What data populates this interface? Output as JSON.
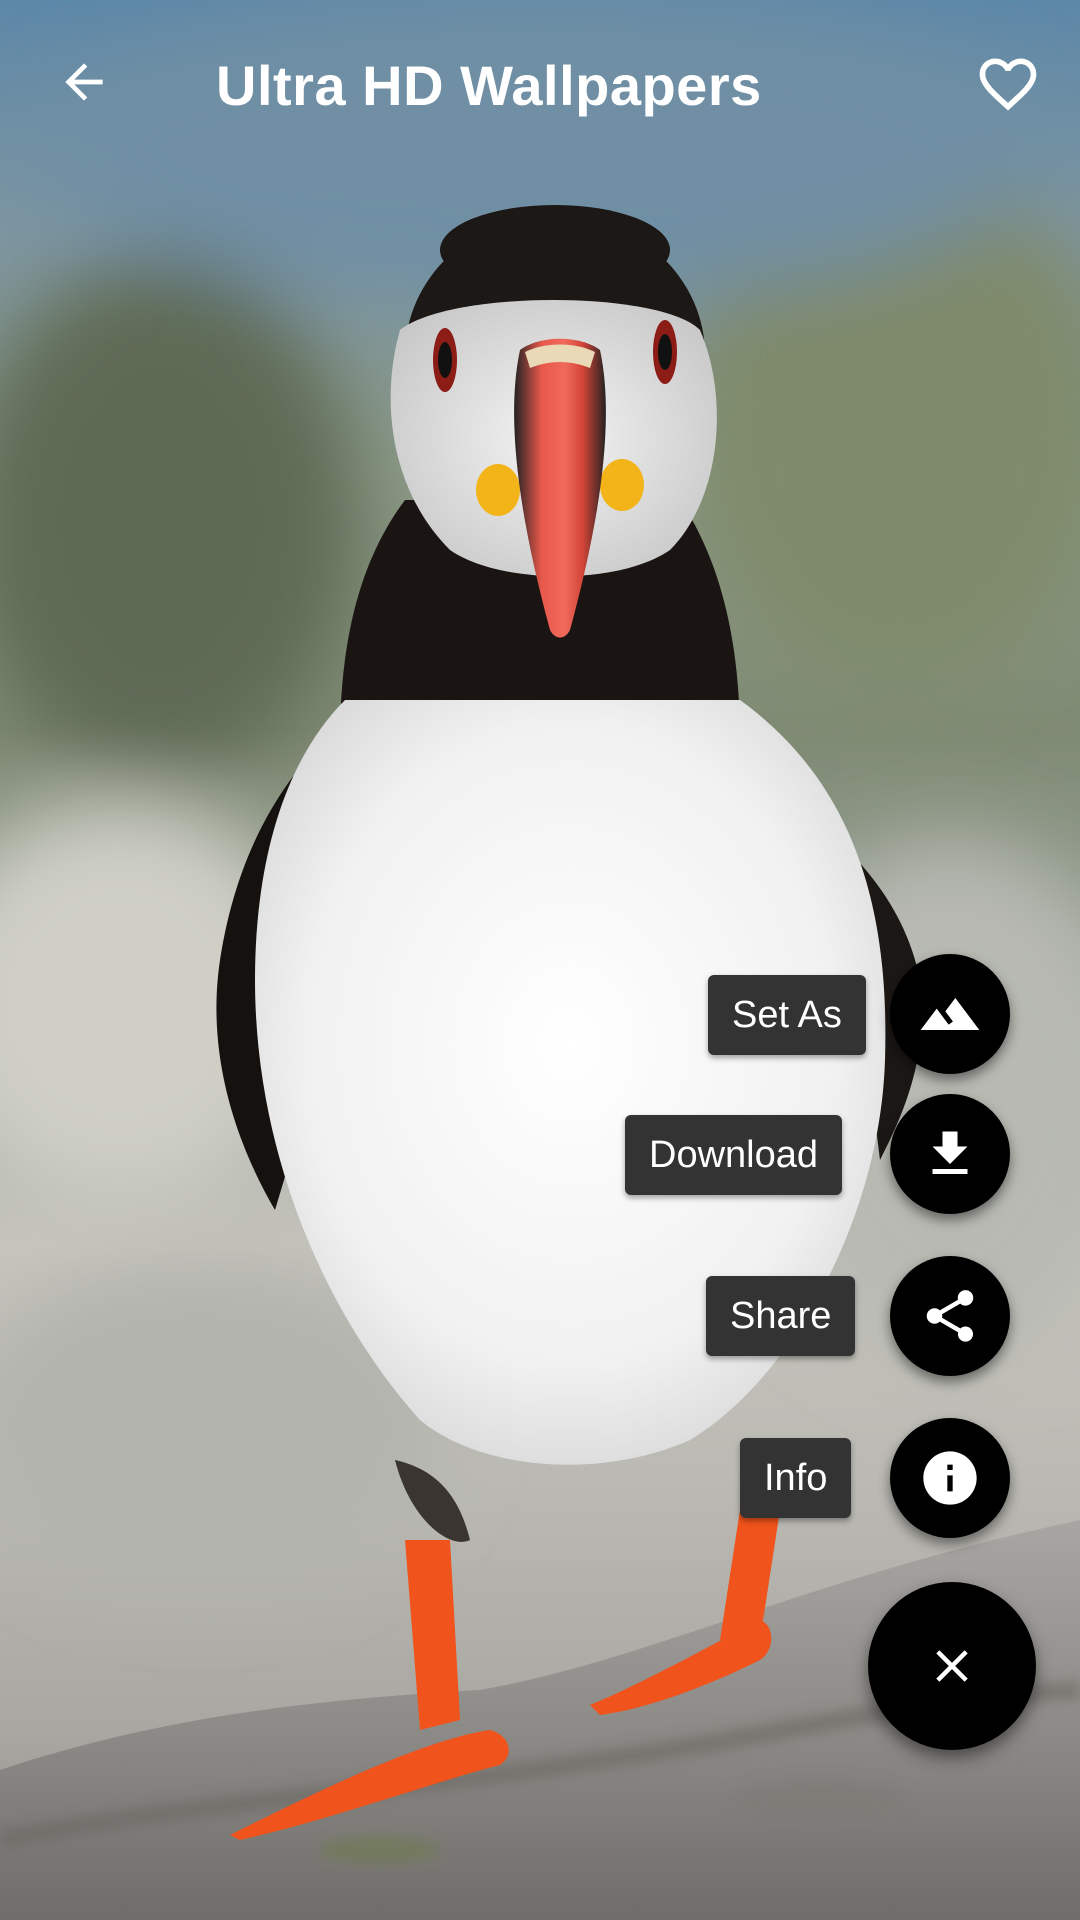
{
  "header": {
    "title": "Ultra HD Wallpapers",
    "back_icon": "arrow-left-icon",
    "favorite_icon": "heart-outline-icon"
  },
  "fab_menu": {
    "actions": [
      {
        "label": "Set As",
        "icon": "landscape-icon"
      },
      {
        "label": "Download",
        "icon": "download-icon"
      },
      {
        "label": "Share",
        "icon": "share-icon"
      },
      {
        "label": "Info",
        "icon": "info-icon"
      }
    ],
    "close_icon": "close-icon"
  },
  "wallpaper": {
    "subject": "puffin-photo"
  },
  "colors": {
    "fab_background": "#000000",
    "label_background": "#333333",
    "text": "#ffffff"
  }
}
